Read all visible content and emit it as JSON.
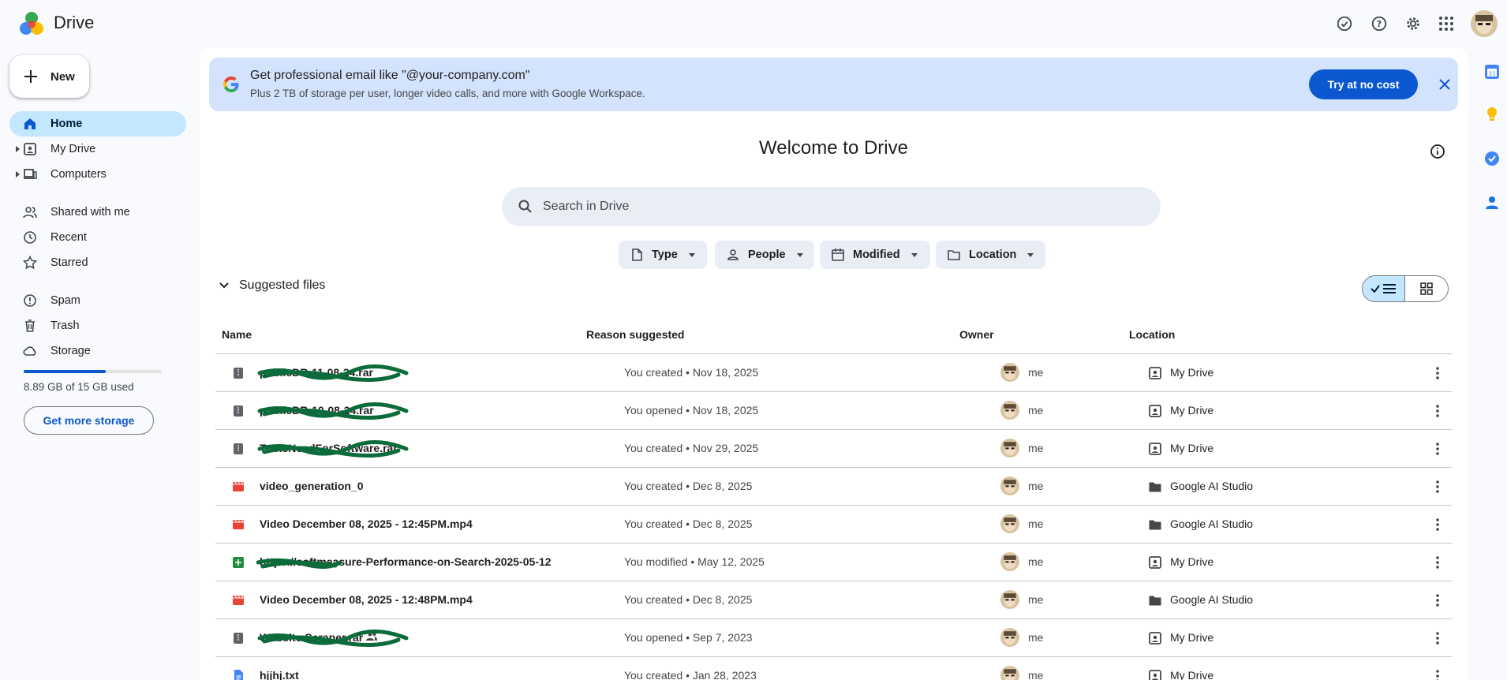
{
  "app": {
    "name": "Drive"
  },
  "sidebar": {
    "new_label": "New",
    "items": [
      {
        "label": "Home",
        "icon": "home-icon",
        "active": true
      },
      {
        "label": "My Drive",
        "icon": "my-drive-icon"
      },
      {
        "label": "Computers",
        "icon": "computers-icon"
      },
      {
        "label": "Shared with me",
        "icon": "shared-icon"
      },
      {
        "label": "Recent",
        "icon": "recent-icon"
      },
      {
        "label": "Starred",
        "icon": "star-icon"
      },
      {
        "label": "Spam",
        "icon": "spam-icon"
      },
      {
        "label": "Trash",
        "icon": "trash-icon"
      },
      {
        "label": "Storage",
        "icon": "cloud-icon"
      }
    ],
    "storage_text": "8.89 GB of 15 GB used",
    "storage_fraction": 0.593,
    "get_storage_label": "Get more storage"
  },
  "promo": {
    "title": "Get professional email like \"@your-company.com\"",
    "subtitle": "Plus 2 TB of storage per user, longer video calls, and more with Google Workspace.",
    "cta": "Try at no cost"
  },
  "main": {
    "welcome": "Welcome to Drive",
    "search_placeholder": "Search in Drive",
    "filters": [
      "Type",
      "People",
      "Modified",
      "Location"
    ],
    "section_title": "Suggested files",
    "columns": [
      "Name",
      "Reason suggested",
      "Owner",
      "Location"
    ]
  },
  "files": [
    {
      "name": "publicDB-11-08-24.rar",
      "redacted": true,
      "type": "archive",
      "reason": "You created • Nov 18, 2025",
      "owner": "me",
      "location": "My Drive",
      "loc_icon": "drive"
    },
    {
      "name": "publicDB-10-08-24.rar",
      "redacted": true,
      "type": "archive",
      "reason": "You opened • Nov 18, 2025",
      "owner": "me",
      "location": "My Drive",
      "loc_icon": "drive"
    },
    {
      "name": "ToolsNeedForSoftware.rar",
      "redacted": true,
      "type": "archive",
      "reason": "You created • Nov 29, 2025",
      "owner": "me",
      "location": "My Drive",
      "loc_icon": "drive"
    },
    {
      "name": "video_generation_0",
      "redacted": false,
      "type": "video",
      "reason": "You created • Dec 8, 2025",
      "owner": "me",
      "location": "Google AI Studio",
      "loc_icon": "folder"
    },
    {
      "name": "Video December 08, 2025 - 12:45PM.mp4",
      "redacted": false,
      "type": "video",
      "reason": "You created • Dec 8, 2025",
      "owner": "me",
      "location": "Google AI Studio",
      "loc_icon": "folder"
    },
    {
      "name": "https://softmeasure-Performance-on-Search-2025-05-12",
      "redacted": false,
      "type": "sheet",
      "reason": "You modified • May 12, 2025",
      "owner": "me",
      "location": "My Drive",
      "loc_icon": "drive"
    },
    {
      "name": "Video December 08, 2025 - 12:48PM.mp4",
      "redacted": false,
      "type": "video",
      "reason": "You created • Dec 8, 2025",
      "owner": "me",
      "location": "Google AI Studio",
      "loc_icon": "folder"
    },
    {
      "name": "Website Scraper.rar",
      "redacted": true,
      "type": "archive",
      "shared": true,
      "reason": "You opened • Sep 7, 2023",
      "owner": "me",
      "location": "My Drive",
      "loc_icon": "drive"
    },
    {
      "name": "hjjhj.txt",
      "redacted": false,
      "type": "doc",
      "reason": "You created • Jan 28, 2023",
      "owner": "me",
      "location": "My Drive",
      "loc_icon": "drive"
    }
  ],
  "colors": {
    "accent": "#0b57d0",
    "active_nav": "#c2e7ff",
    "promo_bg": "#d3e3fd",
    "video_red": "#ea4335",
    "sheet_green": "#1e8e3e",
    "doc_blue": "#4285f4",
    "scribble_green": "#0b6b3a"
  }
}
